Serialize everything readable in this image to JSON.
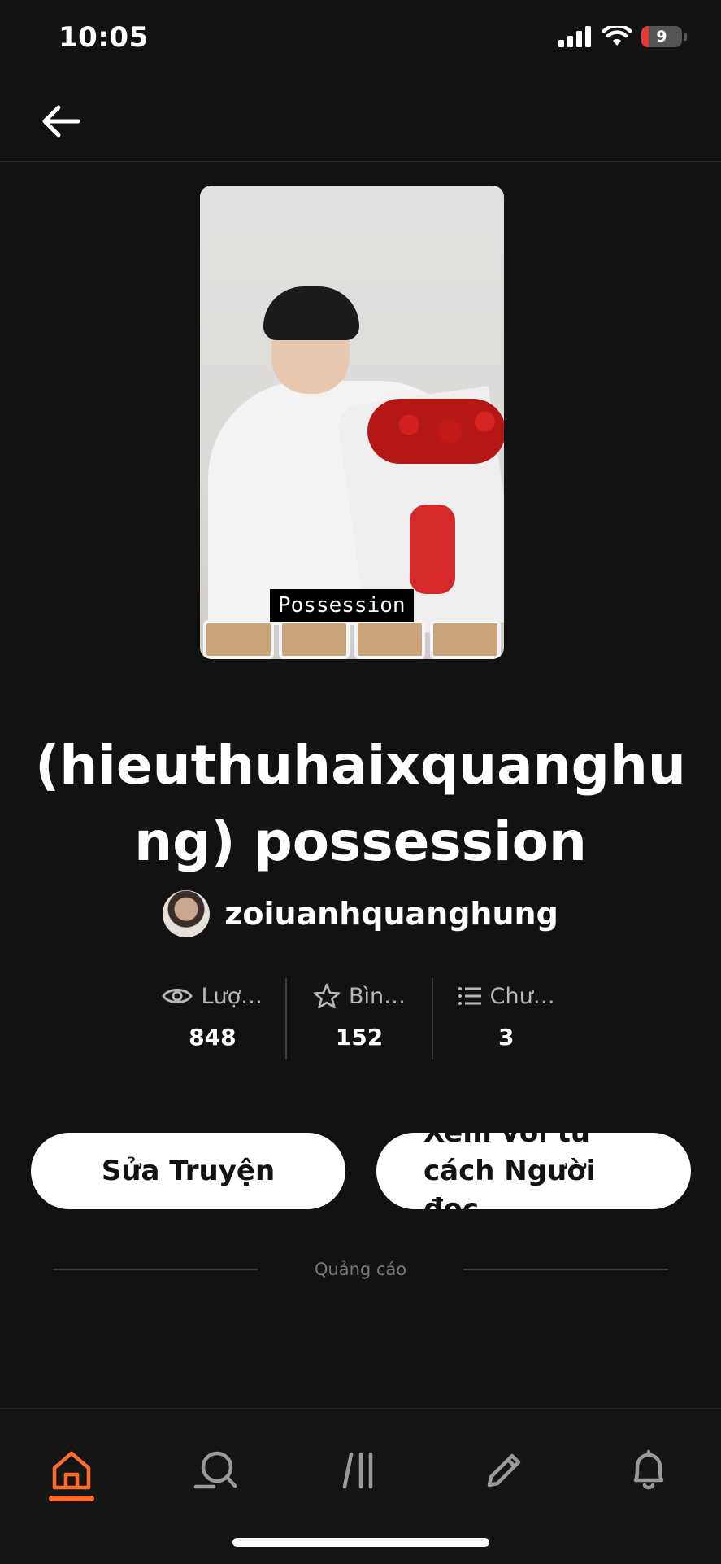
{
  "status_bar": {
    "time": "10:05",
    "battery": "9"
  },
  "cover": {
    "label": "Possession"
  },
  "story": {
    "title": "(hieuthuhaixquanghung) possession",
    "author": "zoiuanhquanghung"
  },
  "stats": [
    {
      "label": "Lượ…",
      "value": "848",
      "icon": "eye-icon"
    },
    {
      "label": "Bìn…",
      "value": "152",
      "icon": "star-icon"
    },
    {
      "label": "Chư…",
      "value": "3",
      "icon": "list-icon"
    }
  ],
  "actions": {
    "edit_label": "Sửa Truyện",
    "view_label": "Xem với tư cách Người đọc"
  },
  "ad": {
    "label": "Quảng cáo"
  },
  "bottom_nav": {
    "items": [
      "home-icon",
      "search-icon",
      "library-icon",
      "write-icon",
      "bell-icon"
    ],
    "active_color": "#ff6b2c"
  }
}
